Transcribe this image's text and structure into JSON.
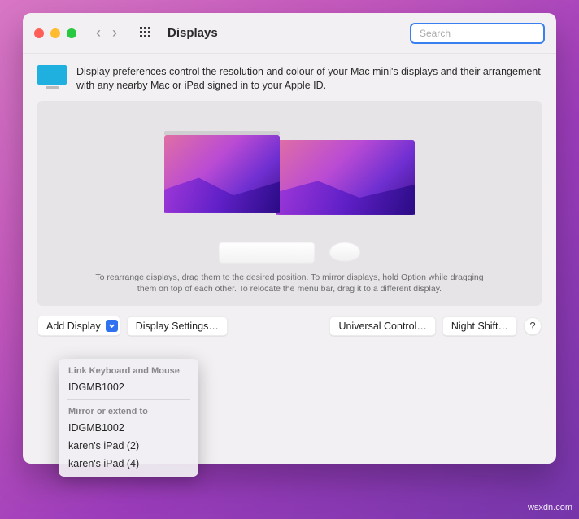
{
  "window": {
    "title": "Displays",
    "search_placeholder": "Search"
  },
  "intro": {
    "text": "Display preferences control the resolution and colour of your Mac mini's displays and their arrangement with any nearby Mac or iPad signed in to your Apple ID."
  },
  "hint": {
    "line1": "To rearrange displays, drag them to the desired position. To mirror displays, hold Option while dragging",
    "line2": "them on top of each other. To relocate the menu bar, drag it to a different display."
  },
  "buttons": {
    "add_display": "Add Display",
    "display_settings": "Display Settings…",
    "universal_control": "Universal Control…",
    "night_shift": "Night Shift…",
    "help": "?"
  },
  "popover": {
    "section1_header": "Link Keyboard and Mouse",
    "section1_items": [
      "IDGMB1002"
    ],
    "section2_header": "Mirror or extend to",
    "section2_items": [
      "IDGMB1002",
      "karen's iPad (2)",
      "karen's iPad (4)"
    ]
  },
  "watermark": "wsxdn.com"
}
